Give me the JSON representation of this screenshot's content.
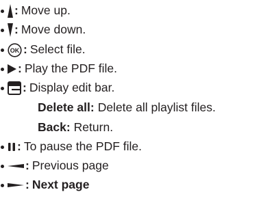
{
  "items": [
    {
      "icon": "move-up-icon",
      "colon": ":",
      "text": "Move up."
    },
    {
      "icon": "move-down-icon",
      "colon": ":",
      "text": "Move down."
    },
    {
      "icon": "ok-icon",
      "icon_text": "OK",
      "colon": ":",
      "text": "Select file."
    },
    {
      "icon": "play-icon",
      "colon": ":",
      "text": "Play the PDF file."
    },
    {
      "icon": "edit-bar-icon",
      "colon": ":",
      "text": "Display edit bar."
    },
    {
      "icon": "pause-icon",
      "colon": ":",
      "text": "To pause the PDF file."
    },
    {
      "icon": "previous-page-icon",
      "colon": ":",
      "text": "Previous page"
    },
    {
      "icon": "next-page-icon",
      "colon": ":",
      "text": "Next page"
    }
  ],
  "edit_bar_options": [
    {
      "label": "Delete all:",
      "text": "Delete all playlist files."
    },
    {
      "label": "Back:",
      "text": "Return."
    }
  ],
  "colors": {
    "text": "#231f20",
    "background": "#ffffff"
  }
}
